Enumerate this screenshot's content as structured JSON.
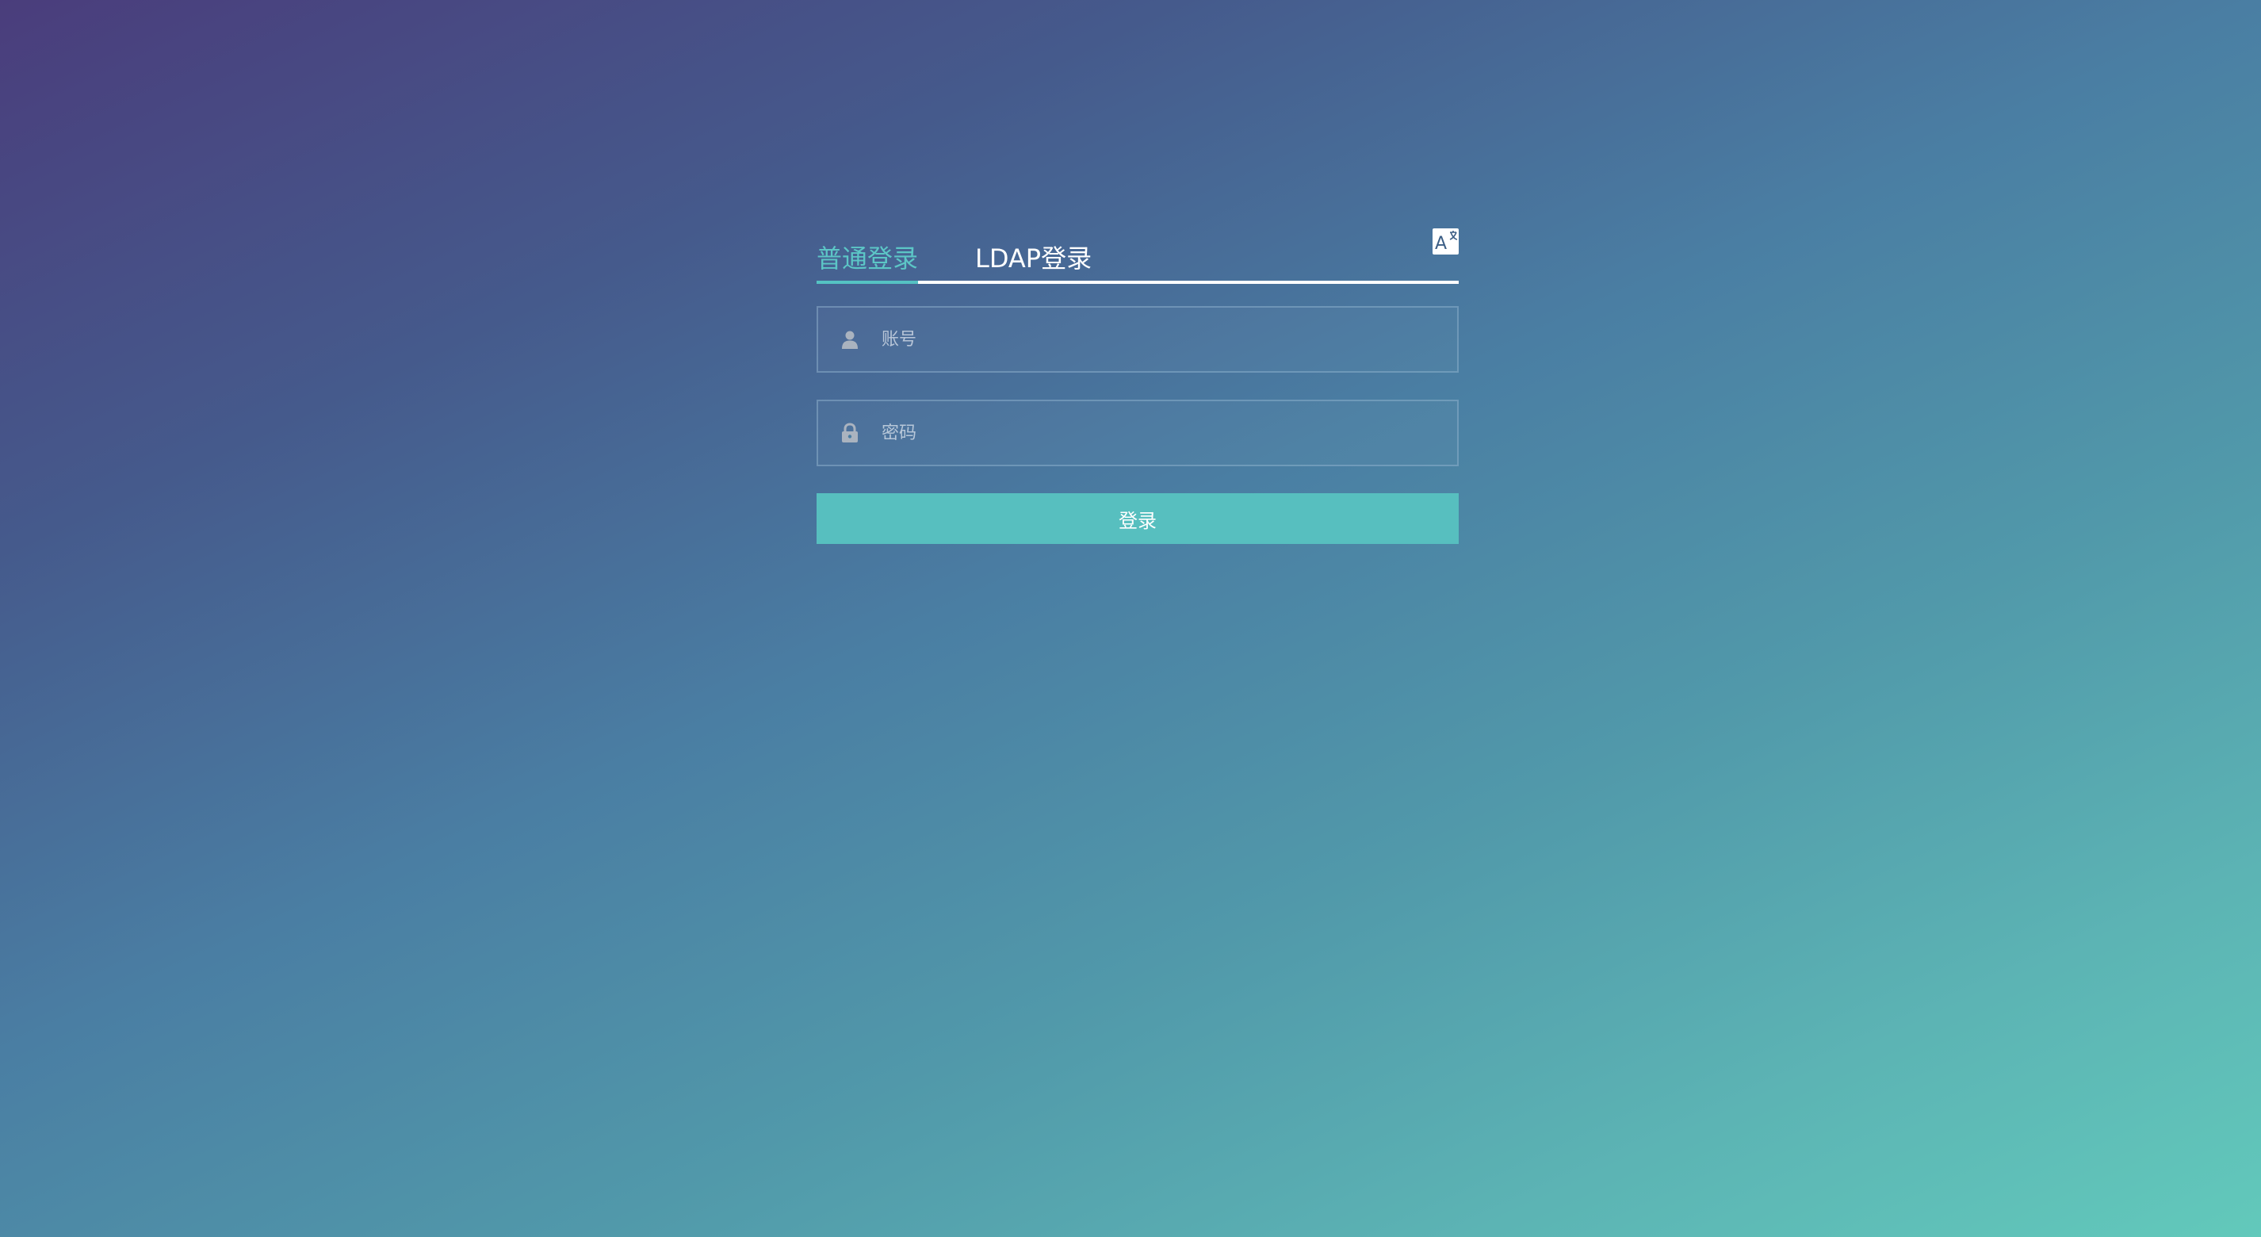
{
  "tabs": {
    "normal_label": "普通登录",
    "ldap_label": "LDAP登录",
    "active": "普通登录"
  },
  "language_toggle": {
    "icon": "translate-icon",
    "glyph": "A"
  },
  "form": {
    "account": {
      "icon": "user-icon",
      "placeholder": "账号",
      "value": ""
    },
    "password": {
      "icon": "lock-icon",
      "placeholder": "密码",
      "value": ""
    },
    "submit_label": "登录"
  },
  "colors": {
    "accent": "#57bfbf",
    "active_tab": "#5cc6c6",
    "text": "#ffffff",
    "background_start": "#4a3d7c",
    "background_end": "#62c9bb"
  }
}
